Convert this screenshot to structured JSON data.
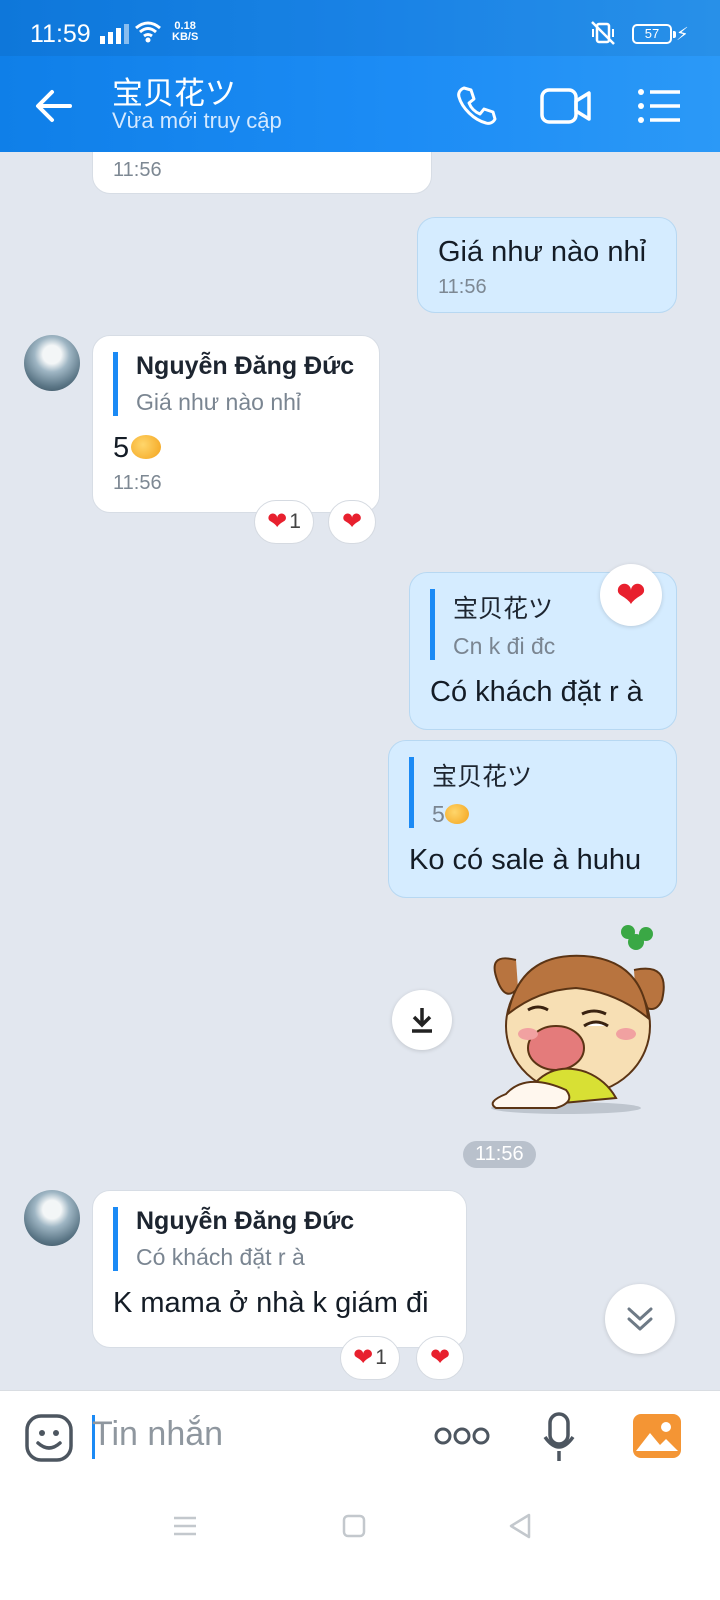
{
  "status_bar": {
    "time": "11:59",
    "net_speed_value": "0.18",
    "net_speed_unit": "KB/S",
    "battery": "57"
  },
  "header": {
    "contact_name": "宝贝花ツ",
    "presence": "Vừa mới truy cập"
  },
  "messages": {
    "m0": {
      "time": "11:56"
    },
    "m1": {
      "text": "Giá như nào nhỉ",
      "time": "11:56"
    },
    "m2": {
      "quote_name": "Nguyễn Đăng Đức",
      "quote_text": "Giá như nào nhỉ",
      "text": "5",
      "time": "11:56",
      "reaction_count": "1"
    },
    "m3": {
      "quote_name": "宝贝花ツ",
      "quote_text": "Cn k đi đc",
      "text": "Có khách đặt r à"
    },
    "m4": {
      "quote_name": "宝贝花ツ",
      "quote_text": "5",
      "text": "Ko có sale à huhu"
    },
    "sticker": {
      "time": "11:56"
    },
    "m5": {
      "quote_name": "Nguyễn Đăng Đức",
      "quote_text": "Có khách đặt r à",
      "text": "K mama ở nhà k giám đi",
      "reaction_count": "1"
    }
  },
  "input": {
    "placeholder": "Tin nhắn"
  },
  "colors": {
    "header_blue": "#1b8af5",
    "bubble_out": "#d5ecff",
    "heart_red": "#e8202e"
  }
}
